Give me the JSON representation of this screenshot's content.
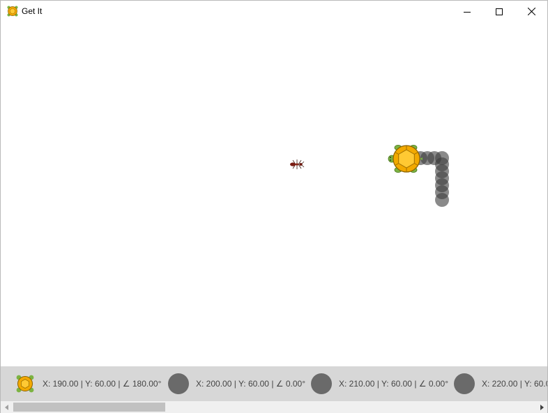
{
  "window": {
    "title": "Get It",
    "icon": "turtle-icon"
  },
  "scene": {
    "player": "turtle",
    "target": "ant",
    "trail_color": "#3c3c3c"
  },
  "status_items": [
    {
      "icon": "turtle-icon",
      "text": "X: 190.00 | Y: 60.00 | ∠ 180.00°"
    },
    {
      "icon": "trail-dot-icon",
      "text": "X: 200.00 | Y: 60.00 | ∠ 0.00°"
    },
    {
      "icon": "trail-dot-icon",
      "text": "X: 210.00 | Y: 60.00 | ∠ 0.00°"
    },
    {
      "icon": "trail-dot-icon",
      "text": "X: 220.00 | Y: 60.0"
    }
  ]
}
